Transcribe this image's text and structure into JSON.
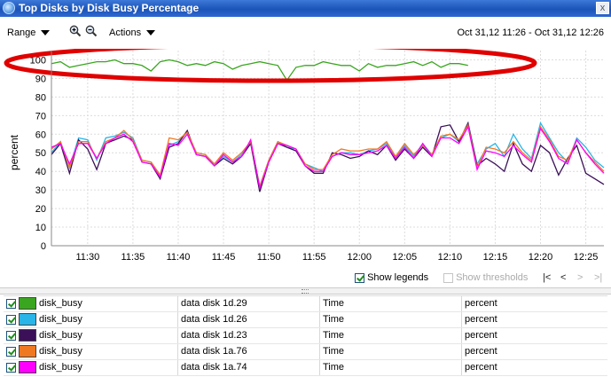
{
  "window": {
    "title": "Top Disks by Disk Busy Percentage",
    "close_label": "x"
  },
  "toolbar": {
    "range_label": "Range",
    "zoom_in_icon": "zoom-in-icon",
    "zoom_out_icon": "zoom-out-icon",
    "actions_label": "Actions",
    "date_range": "Oct 31,12 11:26 - Oct 31,12 12:26"
  },
  "chart_data": {
    "type": "line",
    "ylabel": "percent",
    "ylim": [
      0,
      105
    ],
    "yticks": [
      0,
      10,
      20,
      30,
      40,
      50,
      60,
      70,
      80,
      90,
      100
    ],
    "xlim_minutes": [
      686,
      747
    ],
    "xtick_labels": [
      "11:30",
      "11:35",
      "11:40",
      "11:45",
      "11:50",
      "11:55",
      "12:00",
      "12:05",
      "12:10",
      "12:15",
      "12:20",
      "12:25"
    ],
    "xtick_minutes": [
      690,
      695,
      700,
      705,
      710,
      715,
      720,
      725,
      730,
      735,
      740,
      745
    ],
    "grid": true,
    "annotation": {
      "shape": "ellipse",
      "color": "#e00000",
      "around": "green series near 100"
    },
    "series": [
      {
        "name": "data disk 1d.29",
        "color": "#3aa620",
        "t": [
          686,
          687,
          688,
          689,
          690,
          691,
          692,
          693,
          694,
          695,
          696,
          697,
          698,
          699,
          700,
          701,
          702,
          703,
          704,
          705,
          706,
          707,
          708,
          709,
          710,
          711,
          712,
          713,
          714,
          715,
          716,
          717,
          718,
          719,
          720,
          721,
          722,
          723,
          724,
          725,
          726,
          727,
          728,
          729,
          730,
          731,
          732
        ],
        "values": [
          98,
          99,
          96,
          97,
          98,
          99,
          99,
          100,
          98,
          98,
          97,
          94,
          99,
          100,
          99,
          97,
          98,
          97,
          99,
          98,
          95,
          97,
          98,
          99,
          98,
          97,
          89,
          96,
          97,
          97,
          99,
          98,
          97,
          97,
          94,
          98,
          96,
          97,
          97,
          98,
          99,
          97,
          99,
          96,
          98,
          98,
          97
        ]
      },
      {
        "name": "data disk 1d.26",
        "color": "#29b5e8",
        "t": [
          686,
          687,
          688,
          689,
          690,
          691,
          692,
          693,
          694,
          695,
          696,
          697,
          698,
          699,
          700,
          701,
          702,
          703,
          704,
          705,
          706,
          707,
          708,
          709,
          710,
          711,
          712,
          713,
          714,
          715,
          716,
          717,
          718,
          719,
          720,
          721,
          722,
          723,
          724,
          725,
          726,
          727,
          728,
          729,
          730,
          731,
          732,
          733,
          734,
          735,
          736,
          737,
          738,
          739,
          740,
          741,
          742,
          743,
          744,
          745,
          746,
          747
        ],
        "values": [
          50,
          56,
          42,
          58,
          57,
          46,
          58,
          59,
          61,
          58,
          46,
          45,
          38,
          54,
          56,
          61,
          50,
          49,
          43,
          48,
          45,
          49,
          56,
          32,
          46,
          56,
          53,
          52,
          44,
          42,
          40,
          48,
          50,
          50,
          49,
          51,
          52,
          55,
          47,
          54,
          48,
          55,
          49,
          58,
          60,
          56,
          66,
          44,
          52,
          55,
          48,
          60,
          52,
          47,
          66,
          58,
          50,
          45,
          58,
          53,
          46,
          42
        ]
      },
      {
        "name": "data disk 1d.23",
        "color": "#3b1058",
        "t": [
          686,
          687,
          688,
          689,
          690,
          691,
          692,
          693,
          694,
          695,
          696,
          697,
          698,
          699,
          700,
          701,
          702,
          703,
          704,
          705,
          706,
          707,
          708,
          709,
          710,
          711,
          712,
          713,
          714,
          715,
          716,
          717,
          718,
          719,
          720,
          721,
          722,
          723,
          724,
          725,
          726,
          727,
          728,
          729,
          730,
          731,
          732,
          733,
          734,
          735,
          736,
          737,
          738,
          739,
          740,
          741,
          742,
          743,
          744,
          745,
          746,
          747
        ],
        "values": [
          49,
          55,
          39,
          57,
          52,
          41,
          55,
          57,
          59,
          57,
          45,
          44,
          36,
          53,
          55,
          62,
          49,
          48,
          43,
          47,
          44,
          48,
          55,
          29,
          45,
          55,
          53,
          51,
          43,
          39,
          39,
          50,
          49,
          47,
          48,
          51,
          49,
          54,
          46,
          52,
          47,
          53,
          48,
          64,
          65,
          56,
          66,
          43,
          47,
          44,
          40,
          55,
          44,
          40,
          54,
          50,
          38,
          47,
          54,
          39,
          36,
          33
        ]
      },
      {
        "name": "data disk 1a.76",
        "color": "#f07820",
        "t": [
          686,
          687,
          688,
          689,
          690,
          691,
          692,
          693,
          694,
          695,
          696,
          697,
          698,
          699,
          700,
          701,
          702,
          703,
          704,
          705,
          706,
          707,
          708,
          709,
          710,
          711,
          712,
          713,
          714,
          715,
          716,
          717,
          718,
          719,
          720,
          721,
          722,
          723,
          724,
          725,
          726,
          727,
          728,
          729,
          730,
          731,
          732,
          733,
          734,
          735,
          736,
          737,
          738,
          739,
          740,
          741,
          742,
          743,
          744,
          745,
          746,
          747
        ],
        "values": [
          52,
          56,
          42,
          56,
          56,
          47,
          56,
          58,
          62,
          57,
          46,
          45,
          38,
          58,
          57,
          61,
          50,
          49,
          44,
          50,
          46,
          50,
          56,
          32,
          46,
          56,
          54,
          52,
          44,
          41,
          41,
          49,
          52,
          51,
          51,
          52,
          52,
          56,
          48,
          55,
          49,
          54,
          49,
          59,
          60,
          57,
          65,
          42,
          53,
          52,
          50,
          56,
          50,
          46,
          64,
          57,
          48,
          46,
          57,
          50,
          45,
          40
        ]
      },
      {
        "name": "data disk 1a.74",
        "color": "#ff00ff",
        "t": [
          686,
          687,
          688,
          689,
          690,
          691,
          692,
          693,
          694,
          695,
          696,
          697,
          698,
          699,
          700,
          701,
          702,
          703,
          704,
          705,
          706,
          707,
          708,
          709,
          710,
          711,
          712,
          713,
          714,
          715,
          716,
          717,
          718,
          719,
          720,
          721,
          722,
          723,
          724,
          725,
          726,
          727,
          728,
          729,
          730,
          731,
          732,
          733,
          734,
          735,
          736,
          737,
          738,
          739,
          740,
          741,
          742,
          743,
          744,
          745,
          746,
          747
        ],
        "values": [
          53,
          55,
          44,
          55,
          55,
          47,
          55,
          58,
          60,
          56,
          45,
          44,
          37,
          55,
          54,
          60,
          49,
          48,
          43,
          49,
          45,
          48,
          57,
          31,
          45,
          55,
          54,
          52,
          43,
          40,
          40,
          48,
          50,
          49,
          49,
          50,
          51,
          54,
          47,
          53,
          47,
          55,
          48,
          58,
          58,
          55,
          64,
          41,
          51,
          50,
          48,
          54,
          49,
          45,
          63,
          56,
          47,
          44,
          57,
          50,
          44,
          39
        ]
      }
    ]
  },
  "legend_bar": {
    "show_legends_label": "Show legends",
    "show_thresholds_label": "Show thresholds",
    "first_label": "|<",
    "prev_label": "<",
    "next_label": ">",
    "last_label": ">|"
  },
  "table": {
    "rows": [
      {
        "metric": "disk_busy",
        "object": "data disk 1d.29",
        "axis": "Time",
        "unit": "percent",
        "color": "#3aa620"
      },
      {
        "metric": "disk_busy",
        "object": "data disk 1d.26",
        "axis": "Time",
        "unit": "percent",
        "color": "#29b5e8"
      },
      {
        "metric": "disk_busy",
        "object": "data disk 1d.23",
        "axis": "Time",
        "unit": "percent",
        "color": "#3b1058"
      },
      {
        "metric": "disk_busy",
        "object": "data disk 1a.76",
        "axis": "Time",
        "unit": "percent",
        "color": "#f07820"
      },
      {
        "metric": "disk_busy",
        "object": "data disk 1a.74",
        "axis": "Time",
        "unit": "percent",
        "color": "#ff00ff"
      }
    ]
  }
}
